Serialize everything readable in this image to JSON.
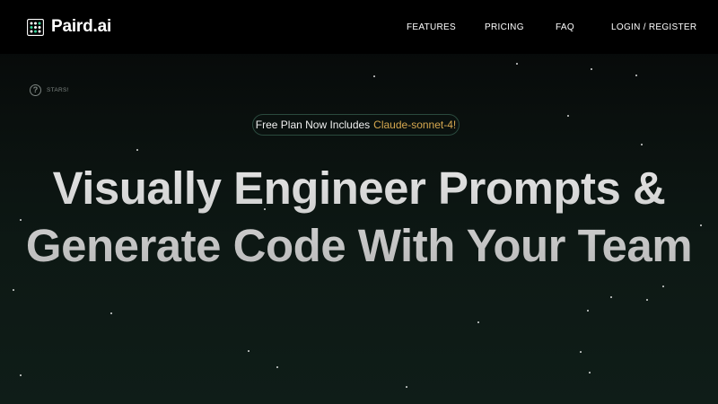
{
  "brand": {
    "name": "Paird.ai",
    "logo_icon": "dot-grid-logo-icon",
    "logo_colors": [
      "#ffffff",
      "#37d39a"
    ]
  },
  "nav": {
    "items": [
      {
        "label": "FEATURES"
      },
      {
        "label": "PRICING"
      },
      {
        "label": "FAQ"
      },
      {
        "label": "LOGIN / REGISTER"
      }
    ]
  },
  "stars_widget": {
    "icon": "help-circle-icon",
    "label": "STARS!"
  },
  "announcement": {
    "text": "Free Plan Now Includes",
    "highlight": "Claude-sonnet-4!",
    "highlight_color": "#d6a84f"
  },
  "hero": {
    "line1": "Visually Engineer Prompts &",
    "line2": "Generate Code With Your Team"
  },
  "colors": {
    "background": "#0a100e",
    "navbar": "#000000",
    "accent_green": "#37d39a"
  }
}
